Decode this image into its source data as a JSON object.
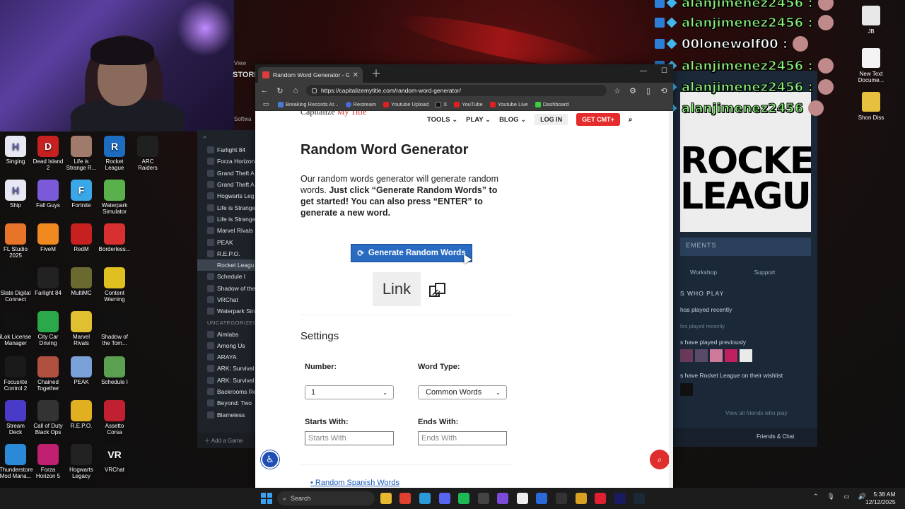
{
  "desktop": {
    "icons_left": [
      {
        "label": "Singing",
        "glyph": "H",
        "color": "#e8e8f4"
      },
      {
        "label": "Dead Island 2",
        "glyph": "D",
        "color": "#c62020"
      },
      {
        "label": "Life is Strange R...",
        "glyph": "",
        "color": "#a07a6a"
      },
      {
        "label": "Rocket League",
        "glyph": "R",
        "color": "#1d6cc0"
      },
      {
        "label": "ARC Raiders",
        "glyph": "",
        "color": "#202020"
      },
      {
        "label": "Ship",
        "glyph": "H",
        "color": "#e8e8f4"
      },
      {
        "label": "Fall Guys",
        "glyph": "",
        "color": "#7a5ad8"
      },
      {
        "label": "Fortnite",
        "glyph": "F",
        "color": "#3aa7e8"
      },
      {
        "label": "Waterpark Simulator",
        "glyph": "",
        "color": "#5ab04a"
      },
      {
        "label": "FL Studio 2025",
        "glyph": "",
        "color": "#e8742a"
      },
      {
        "label": "FiveM",
        "glyph": "",
        "color": "#f08a20"
      },
      {
        "label": "RedM",
        "glyph": "",
        "color": "#c62020"
      },
      {
        "label": "Borderless...",
        "glyph": "",
        "color": "#d83030"
      },
      {
        "label": "Slate Digital Connect",
        "glyph": "",
        "color": "#111"
      },
      {
        "label": "Farlight 84",
        "glyph": "",
        "color": "#222"
      },
      {
        "label": "MultiMC",
        "glyph": "",
        "color": "#6a6a30"
      },
      {
        "label": "Content Warning",
        "glyph": "",
        "color": "#e0c020"
      },
      {
        "label": "iLok License Manager",
        "glyph": "",
        "color": "#111"
      },
      {
        "label": "City Car Driving",
        "glyph": "",
        "color": "#2aa84a"
      },
      {
        "label": "Marvel Rivals",
        "glyph": "",
        "color": "#e0c030"
      },
      {
        "label": "Shadow of the Tom...",
        "glyph": "",
        "color": "#111"
      },
      {
        "label": "Focusrite Control 2",
        "glyph": "",
        "color": "#1a1a1a"
      },
      {
        "label": "Chained Together",
        "glyph": "",
        "color": "#b05040"
      },
      {
        "label": "PEAK",
        "glyph": "",
        "color": "#7aa0d8"
      },
      {
        "label": "Schedule I",
        "glyph": "",
        "color": "#5aa050"
      },
      {
        "label": "Stream Deck",
        "glyph": "",
        "color": "#4a3ac8"
      },
      {
        "label": "Call of Duty Black Ops",
        "glyph": "",
        "color": "#333"
      },
      {
        "label": "R.E.P.O.",
        "glyph": "",
        "color": "#e0b020"
      },
      {
        "label": "Assetto Corsa",
        "glyph": "",
        "color": "#c02030"
      },
      {
        "label": "Thunderstore Mod Mana...",
        "glyph": "",
        "color": "#2a8ad8"
      },
      {
        "label": "Forza Horizon 5",
        "glyph": "",
        "color": "#c02070"
      },
      {
        "label": "Hogwarts Legacy",
        "glyph": "",
        "color": "#222"
      },
      {
        "label": "VRChat",
        "glyph": "VR",
        "color": "#111"
      }
    ],
    "icons_right": [
      {
        "label": "JB"
      },
      {
        "label": "New Text Docume..."
      },
      {
        "label": "Shon Diss"
      }
    ]
  },
  "steam": {
    "top_menu": "View",
    "store_tab": "STORE",
    "software_label": "Softwa",
    "library": [
      {
        "label": "Farlight 84",
        "active": false
      },
      {
        "label": "Forza Horizon",
        "active": false
      },
      {
        "label": "Grand Theft A",
        "active": false
      },
      {
        "label": "Grand Theft A",
        "active": false
      },
      {
        "label": "Hogwarts Leg",
        "active": false
      },
      {
        "label": "Life is Strange",
        "active": false
      },
      {
        "label": "Life is Strange",
        "active": false
      },
      {
        "label": "Marvel Rivals",
        "active": false
      },
      {
        "label": "PEAK",
        "active": false
      },
      {
        "label": "R.E.P.O.",
        "active": false
      },
      {
        "label": "Rocket Leagu",
        "active": true
      },
      {
        "label": "Schedule I",
        "active": false
      },
      {
        "label": "Shadow of the",
        "active": false
      },
      {
        "label": "VRChat",
        "active": false
      },
      {
        "label": "Waterpark Sin",
        "active": false
      }
    ],
    "category": "UNCATEGORIZED",
    "uncategorized": [
      "Aimlabs",
      "Among Us",
      "ARAYA",
      "ARK: Survival",
      "ARK: Survival",
      "Backrooms Re",
      "Beyond: Two",
      "Blameless"
    ],
    "add_game": "Add a Game",
    "game": {
      "banner_line1": "ROCKET",
      "banner_line2": "LEAGUE",
      "achievements": "EMENTS",
      "tabs": [
        "Workshop",
        "Support"
      ],
      "friends_heading": "S WHO PLAY",
      "played_recently": "has played recently",
      "hrs_recently": "hrs played recently",
      "played_previously": "s have played previously",
      "wishlist": "s have Rocket League on their wishlist",
      "view_all": "View all friends who play",
      "friends_chat": "Friends & Chat"
    }
  },
  "chat": [
    {
      "name": "alanjimenez2456 :",
      "wolf": false
    },
    {
      "name": "alanjimenez2456 :",
      "wolf": false
    },
    {
      "name": "00lonewolf00 :",
      "wolf": true
    },
    {
      "name": "alanjimenez2456 :",
      "wolf": false
    },
    {
      "name": "alanjimenez2456 :",
      "wolf": false
    },
    {
      "name": "alanjimenez2456",
      "wolf": false
    }
  ],
  "browser": {
    "tab_title": "Random Word Generator - Gene",
    "url": "https://capitalizemytitle.com/random-word-generator/",
    "bookmarks": [
      "Breaking Records Ar...",
      "Restream",
      "Youtube Upload",
      "X",
      "YouTube",
      "Youtube Live",
      "Dashboard"
    ],
    "site": {
      "logo_main": "Capitalize",
      "logo_accent": "My Title",
      "nav": [
        "TOOLS ⌄",
        "PLAY ⌄",
        "BLOG ⌄"
      ],
      "login": "LOG IN",
      "cta": "GET CMT+",
      "heading": "Random Word Generator",
      "intro_plain": "Our random words generator will generate random words.",
      "intro_bold": "Just click “Generate Random Words” to get started! You can also press “ENTER” to generate a new word.",
      "generate_button": "Generate Random Words",
      "result_word": "Link",
      "settings_heading": "Settings",
      "number_label": "Number:",
      "number_value": "1",
      "word_type_label": "Word Type:",
      "word_type_value": "Common Words",
      "starts_with_label": "Starts With:",
      "starts_with_placeholder": "Starts With",
      "ends_with_label": "Ends With:",
      "ends_with_placeholder": "Ends With",
      "related_link": "Random Spanish Words"
    }
  },
  "taskbar": {
    "search_placeholder": "Search",
    "time": "5:38 AM",
    "date": "12/12/2025"
  }
}
